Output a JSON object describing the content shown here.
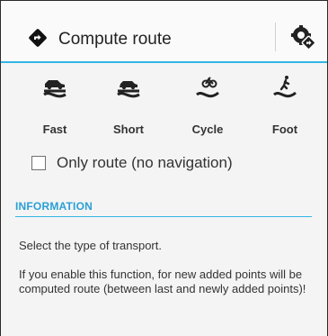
{
  "header": {
    "title": "Compute route",
    "icon": "route-navigation-icon",
    "action_icon": "route-settings-icon"
  },
  "transport_modes": [
    {
      "label": "Fast",
      "icon": "fast-car-icon"
    },
    {
      "label": "Short",
      "icon": "short-car-icon"
    },
    {
      "label": "Cycle",
      "icon": "cycle-icon"
    },
    {
      "label": "Foot",
      "icon": "foot-icon"
    }
  ],
  "options": {
    "only_route_label": "Only route (no navigation)",
    "only_route_checked": false
  },
  "information": {
    "title": "INFORMATION",
    "line1": "Select the type of transport.",
    "paragraph": "If you enable this function, for new added points will be computed route (between last and newly added points)!"
  },
  "colors": {
    "accent": "#33b5e5",
    "section_title": "#2a9fd6"
  }
}
